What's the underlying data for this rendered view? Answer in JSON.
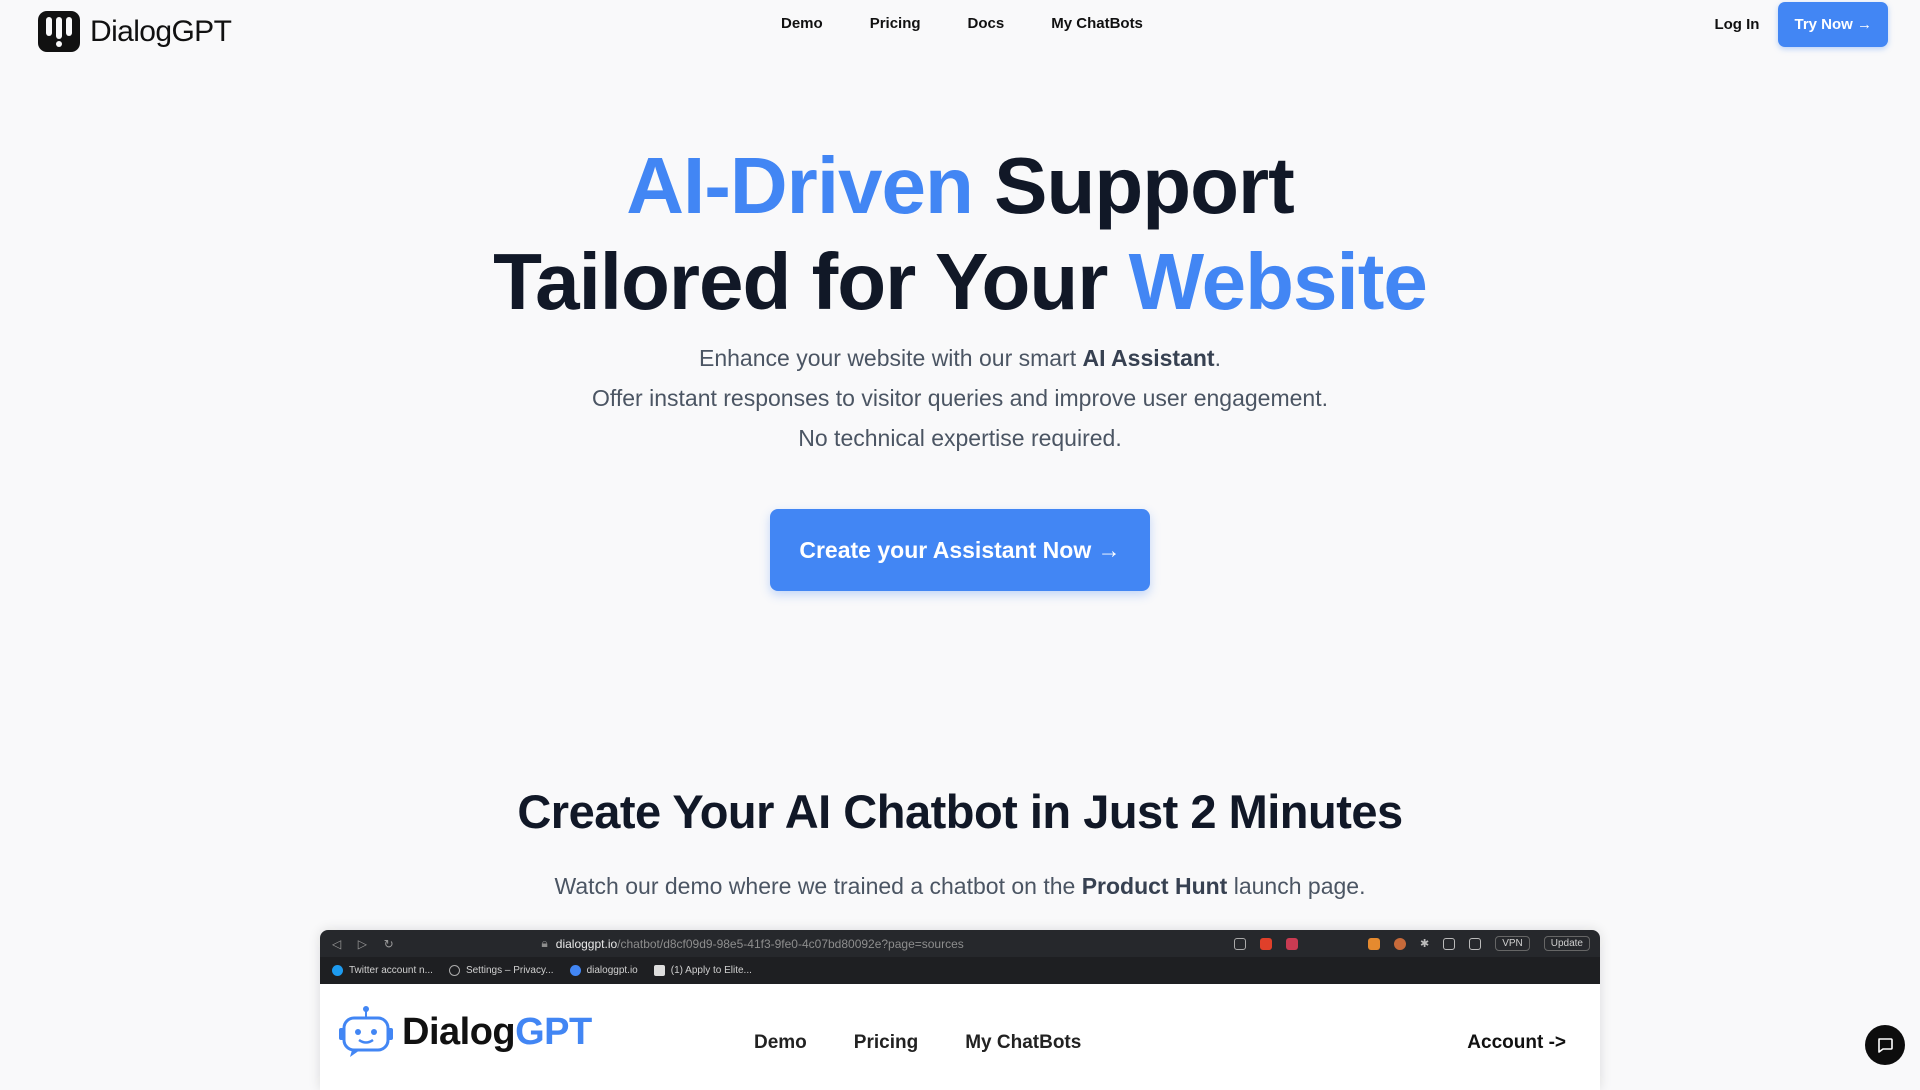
{
  "nav": {
    "brand": "DialogGPT",
    "links": [
      "Demo",
      "Pricing",
      "Docs",
      "My ChatBots"
    ],
    "login": "Log In",
    "try_now": "Try Now →"
  },
  "hero": {
    "title_accent_1": "AI-Driven",
    "title_rest_1": " Support",
    "title_rest_2": "Tailored for Your ",
    "title_accent_2": "Website",
    "sub_line1_pre": "Enhance your website with our smart ",
    "sub_line1_bold": "AI Assistant",
    "sub_line1_post": ".",
    "sub_line2": "Offer instant responses to visitor queries and improve user engagement.",
    "sub_line3": "No technical expertise required.",
    "cta": "Create your Assistant Now →"
  },
  "section": {
    "title": "Create Your AI Chatbot in Just 2 Minutes",
    "sub_pre": "Watch our demo where we trained a chatbot on the ",
    "sub_bold": "Product Hunt",
    "sub_post": " launch page."
  },
  "demo": {
    "url_host": "dialoggpt.io",
    "url_path": "/chatbot/d8cf09d9-98e5-41f3-9fe0-4c07bd80092e?page=sources",
    "vpn": "VPN",
    "update": "Update",
    "bookmarks": [
      "Twitter account n...",
      "Settings – Privacy...",
      "dialoggpt.io",
      "(1) Apply to Elite..."
    ],
    "brand_main": "Dialog",
    "brand_accent": "GPT",
    "nav": [
      "Demo",
      "Pricing",
      "My ChatBots"
    ],
    "account": "Account ->"
  },
  "colors": {
    "accent": "#4286f4",
    "text": "#111827",
    "muted": "#4b5563",
    "background": "#f9f9fa"
  },
  "icons": {
    "brand": "dialoggpt-logo-icon",
    "chat": "chat-bubble-icon",
    "bot": "robot-icon"
  }
}
